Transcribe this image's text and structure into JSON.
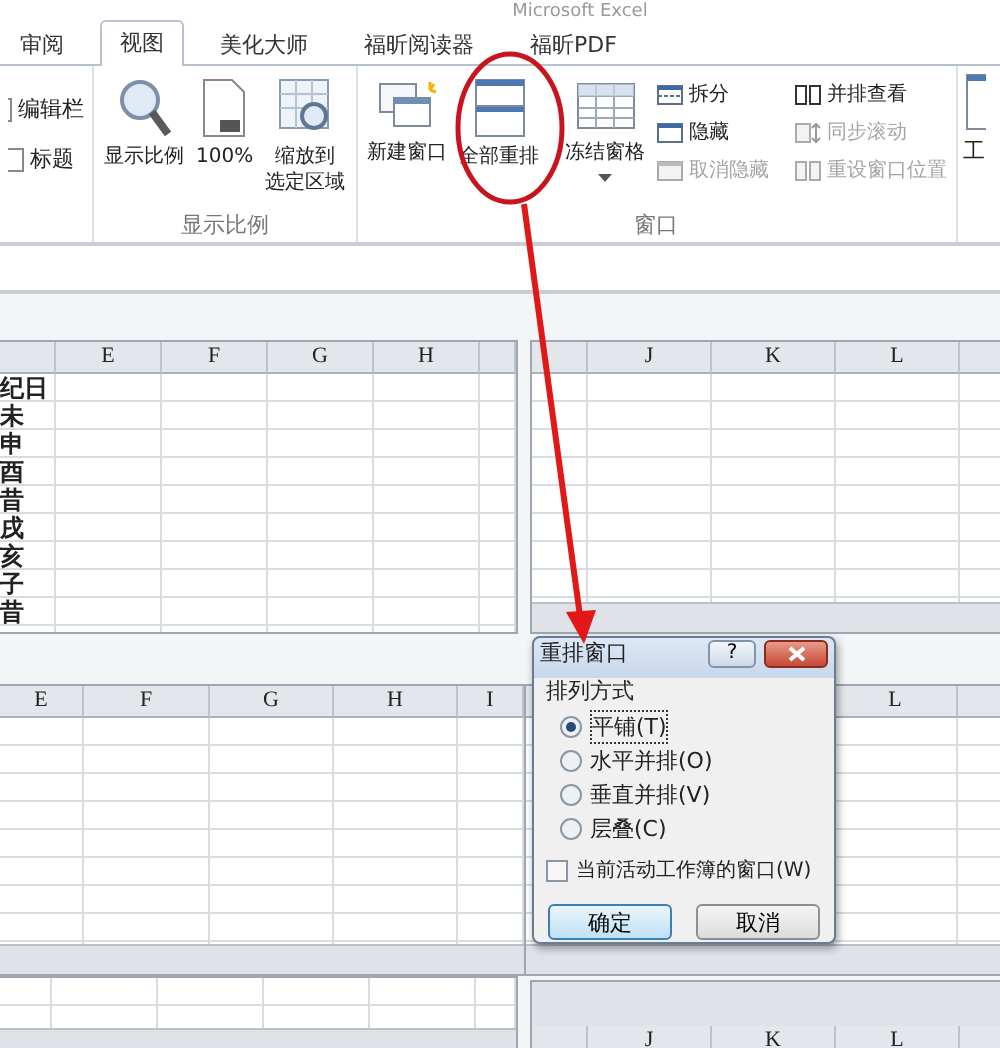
{
  "window": {
    "title": "Microsoft Excel"
  },
  "tabs": [
    {
      "label": "审阅",
      "selected": false
    },
    {
      "label": "视图",
      "selected": true
    },
    {
      "label": "美化大师",
      "selected": false
    },
    {
      "label": "福昕阅读器",
      "selected": false
    },
    {
      "label": "福昕PDF",
      "selected": false
    }
  ],
  "ribbon": {
    "show_group": {
      "checkboxes": [
        {
          "label": "编辑栏",
          "checked": false
        },
        {
          "label": "标题",
          "checked": false
        }
      ]
    },
    "zoom_group": {
      "label": "显示比例",
      "buttons": [
        {
          "lines": [
            "显示比例"
          ],
          "kind": "magnifier"
        },
        {
          "lines": [
            "100%"
          ],
          "kind": "page"
        },
        {
          "lines": [
            "缩放到",
            "选定区域"
          ],
          "kind": "grid-zoom"
        }
      ]
    },
    "window_group": {
      "label": "窗口",
      "large_buttons": [
        {
          "label": "新建窗口",
          "kind": "new-window",
          "dropdown": false
        },
        {
          "label": "全部重排",
          "kind": "arrange",
          "dropdown": false
        },
        {
          "label": "冻结窗格",
          "kind": "freeze",
          "dropdown": true
        }
      ],
      "small_buttons": [
        {
          "label": "拆分",
          "kind": "split",
          "disabled": false
        },
        {
          "label": "隐藏",
          "kind": "hide",
          "disabled": false
        },
        {
          "label": "取消隐藏",
          "kind": "unhide",
          "disabled": true
        },
        {
          "label": "并排查看",
          "kind": "side",
          "disabled": false
        },
        {
          "label": "同步滚动",
          "kind": "sync",
          "disabled": true
        },
        {
          "label": "重设窗口位置",
          "kind": "reset",
          "disabled": true
        }
      ]
    },
    "partial_button": {
      "label": "工"
    }
  },
  "panes": [
    {
      "columns": [
        "E",
        "F",
        "G",
        "H"
      ],
      "column_1_cells": [
        "纪日",
        "未",
        "申",
        "酉",
        "昔",
        "戌",
        "亥",
        "子",
        "昔"
      ]
    },
    {
      "columns": [
        "J",
        "K",
        "L"
      ]
    },
    {
      "columns": [
        "E",
        "F",
        "G",
        "H",
        "I"
      ]
    },
    {
      "columns": [
        "L"
      ]
    },
    {
      "columns": [
        "J",
        "K",
        "L"
      ]
    }
  ],
  "dialog": {
    "title": "重排窗口",
    "help": "?",
    "group_label": "排列方式",
    "options": [
      {
        "label": "平铺(T)",
        "selected": true
      },
      {
        "label": "水平并排(O)",
        "selected": false
      },
      {
        "label": "垂直并排(V)",
        "selected": false
      },
      {
        "label": "层叠(C)",
        "selected": false
      }
    ],
    "checkbox": {
      "label": "当前活动工作簿的窗口(W)",
      "checked": false
    },
    "buttons": [
      {
        "label": "确定",
        "kind": "default"
      },
      {
        "label": "取消",
        "kind": "normal"
      }
    ]
  }
}
